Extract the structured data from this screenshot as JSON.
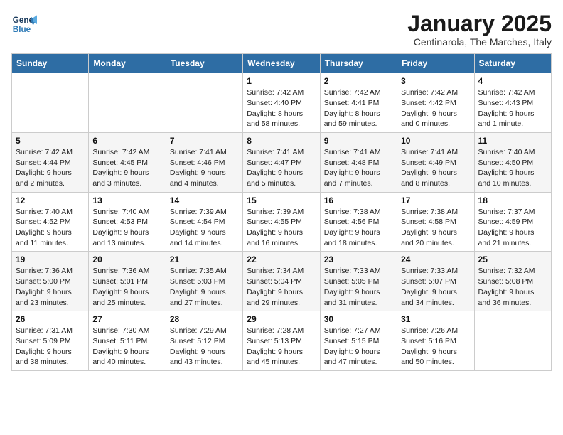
{
  "header": {
    "logo_line1": "General",
    "logo_line2": "Blue",
    "month": "January 2025",
    "location": "Centinarola, The Marches, Italy"
  },
  "columns": [
    "Sunday",
    "Monday",
    "Tuesday",
    "Wednesday",
    "Thursday",
    "Friday",
    "Saturday"
  ],
  "weeks": [
    [
      {
        "day": "",
        "info": ""
      },
      {
        "day": "",
        "info": ""
      },
      {
        "day": "",
        "info": ""
      },
      {
        "day": "1",
        "info": "Sunrise: 7:42 AM\nSunset: 4:40 PM\nDaylight: 8 hours and 58 minutes."
      },
      {
        "day": "2",
        "info": "Sunrise: 7:42 AM\nSunset: 4:41 PM\nDaylight: 8 hours and 59 minutes."
      },
      {
        "day": "3",
        "info": "Sunrise: 7:42 AM\nSunset: 4:42 PM\nDaylight: 9 hours and 0 minutes."
      },
      {
        "day": "4",
        "info": "Sunrise: 7:42 AM\nSunset: 4:43 PM\nDaylight: 9 hours and 1 minute."
      }
    ],
    [
      {
        "day": "5",
        "info": "Sunrise: 7:42 AM\nSunset: 4:44 PM\nDaylight: 9 hours and 2 minutes."
      },
      {
        "day": "6",
        "info": "Sunrise: 7:42 AM\nSunset: 4:45 PM\nDaylight: 9 hours and 3 minutes."
      },
      {
        "day": "7",
        "info": "Sunrise: 7:41 AM\nSunset: 4:46 PM\nDaylight: 9 hours and 4 minutes."
      },
      {
        "day": "8",
        "info": "Sunrise: 7:41 AM\nSunset: 4:47 PM\nDaylight: 9 hours and 5 minutes."
      },
      {
        "day": "9",
        "info": "Sunrise: 7:41 AM\nSunset: 4:48 PM\nDaylight: 9 hours and 7 minutes."
      },
      {
        "day": "10",
        "info": "Sunrise: 7:41 AM\nSunset: 4:49 PM\nDaylight: 9 hours and 8 minutes."
      },
      {
        "day": "11",
        "info": "Sunrise: 7:40 AM\nSunset: 4:50 PM\nDaylight: 9 hours and 10 minutes."
      }
    ],
    [
      {
        "day": "12",
        "info": "Sunrise: 7:40 AM\nSunset: 4:52 PM\nDaylight: 9 hours and 11 minutes."
      },
      {
        "day": "13",
        "info": "Sunrise: 7:40 AM\nSunset: 4:53 PM\nDaylight: 9 hours and 13 minutes."
      },
      {
        "day": "14",
        "info": "Sunrise: 7:39 AM\nSunset: 4:54 PM\nDaylight: 9 hours and 14 minutes."
      },
      {
        "day": "15",
        "info": "Sunrise: 7:39 AM\nSunset: 4:55 PM\nDaylight: 9 hours and 16 minutes."
      },
      {
        "day": "16",
        "info": "Sunrise: 7:38 AM\nSunset: 4:56 PM\nDaylight: 9 hours and 18 minutes."
      },
      {
        "day": "17",
        "info": "Sunrise: 7:38 AM\nSunset: 4:58 PM\nDaylight: 9 hours and 20 minutes."
      },
      {
        "day": "18",
        "info": "Sunrise: 7:37 AM\nSunset: 4:59 PM\nDaylight: 9 hours and 21 minutes."
      }
    ],
    [
      {
        "day": "19",
        "info": "Sunrise: 7:36 AM\nSunset: 5:00 PM\nDaylight: 9 hours and 23 minutes."
      },
      {
        "day": "20",
        "info": "Sunrise: 7:36 AM\nSunset: 5:01 PM\nDaylight: 9 hours and 25 minutes."
      },
      {
        "day": "21",
        "info": "Sunrise: 7:35 AM\nSunset: 5:03 PM\nDaylight: 9 hours and 27 minutes."
      },
      {
        "day": "22",
        "info": "Sunrise: 7:34 AM\nSunset: 5:04 PM\nDaylight: 9 hours and 29 minutes."
      },
      {
        "day": "23",
        "info": "Sunrise: 7:33 AM\nSunset: 5:05 PM\nDaylight: 9 hours and 31 minutes."
      },
      {
        "day": "24",
        "info": "Sunrise: 7:33 AM\nSunset: 5:07 PM\nDaylight: 9 hours and 34 minutes."
      },
      {
        "day": "25",
        "info": "Sunrise: 7:32 AM\nSunset: 5:08 PM\nDaylight: 9 hours and 36 minutes."
      }
    ],
    [
      {
        "day": "26",
        "info": "Sunrise: 7:31 AM\nSunset: 5:09 PM\nDaylight: 9 hours and 38 minutes."
      },
      {
        "day": "27",
        "info": "Sunrise: 7:30 AM\nSunset: 5:11 PM\nDaylight: 9 hours and 40 minutes."
      },
      {
        "day": "28",
        "info": "Sunrise: 7:29 AM\nSunset: 5:12 PM\nDaylight: 9 hours and 43 minutes."
      },
      {
        "day": "29",
        "info": "Sunrise: 7:28 AM\nSunset: 5:13 PM\nDaylight: 9 hours and 45 minutes."
      },
      {
        "day": "30",
        "info": "Sunrise: 7:27 AM\nSunset: 5:15 PM\nDaylight: 9 hours and 47 minutes."
      },
      {
        "day": "31",
        "info": "Sunrise: 7:26 AM\nSunset: 5:16 PM\nDaylight: 9 hours and 50 minutes."
      },
      {
        "day": "",
        "info": ""
      }
    ]
  ]
}
